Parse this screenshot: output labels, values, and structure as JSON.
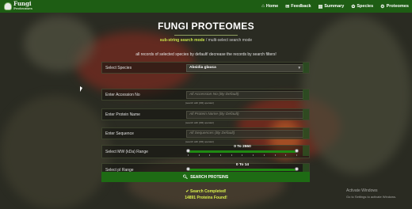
{
  "nav": {
    "logo_text": "Fungi",
    "logo_sub": "Proteomes",
    "items": [
      {
        "icon": "home-icon",
        "glyph": "⌂",
        "label": "Home"
      },
      {
        "icon": "feedback-icon",
        "glyph": "✉",
        "label": "Feedback"
      },
      {
        "icon": "summary-icon",
        "glyph": "▤",
        "label": "Summary"
      },
      {
        "icon": "species-icon",
        "glyph": "✿",
        "label": "Species"
      },
      {
        "icon": "proteomes-icon",
        "glyph": "⚙",
        "label": "Proteomes"
      }
    ]
  },
  "page": {
    "title": "FUNGI PROTEOMES",
    "mode_active": "sub-string search mode",
    "mode_separator": " / ",
    "mode_inactive": "multi-select search mode",
    "notice": "all records of selected species by default! decrease the records by search filters!"
  },
  "form": {
    "species": {
      "label": "Select Species",
      "value": "Absidia glauca"
    },
    "accession": {
      "label": "Enter Accession No",
      "placeholder": "All Accession No (By Default)"
    },
    "protein_name": {
      "label": "Enter Protein Name",
      "placeholder": "All Protein Name (By Default)"
    },
    "sequence": {
      "label": "Enter Sequence",
      "placeholder": "All Sequences (By Default)"
    },
    "mw_range": {
      "label": "Select MW (kDa) Range",
      "value": "0 To 2550",
      "min": 0,
      "max": 2550,
      "low_frac": 0,
      "high_frac": 1
    },
    "pi_range": {
      "label": "Select pI Range",
      "value": "0 To 14",
      "min": 0,
      "max": 14,
      "low_frac": 0,
      "high_frac": 1
    },
    "hint": "(search with [OR] operator)"
  },
  "search_button": {
    "label": "SEARCH PROTEINS",
    "icon": "search-icon"
  },
  "result": {
    "status": "✔ Search Completed!",
    "count": "14891 Proteins Found!"
  },
  "watermark": {
    "line1": "Activate Windows",
    "line2": "Go to Settings to activate Windows."
  },
  "colors": {
    "nav": "#1e5d14",
    "accent": "#c9e34a",
    "button": "#1e6b14"
  }
}
